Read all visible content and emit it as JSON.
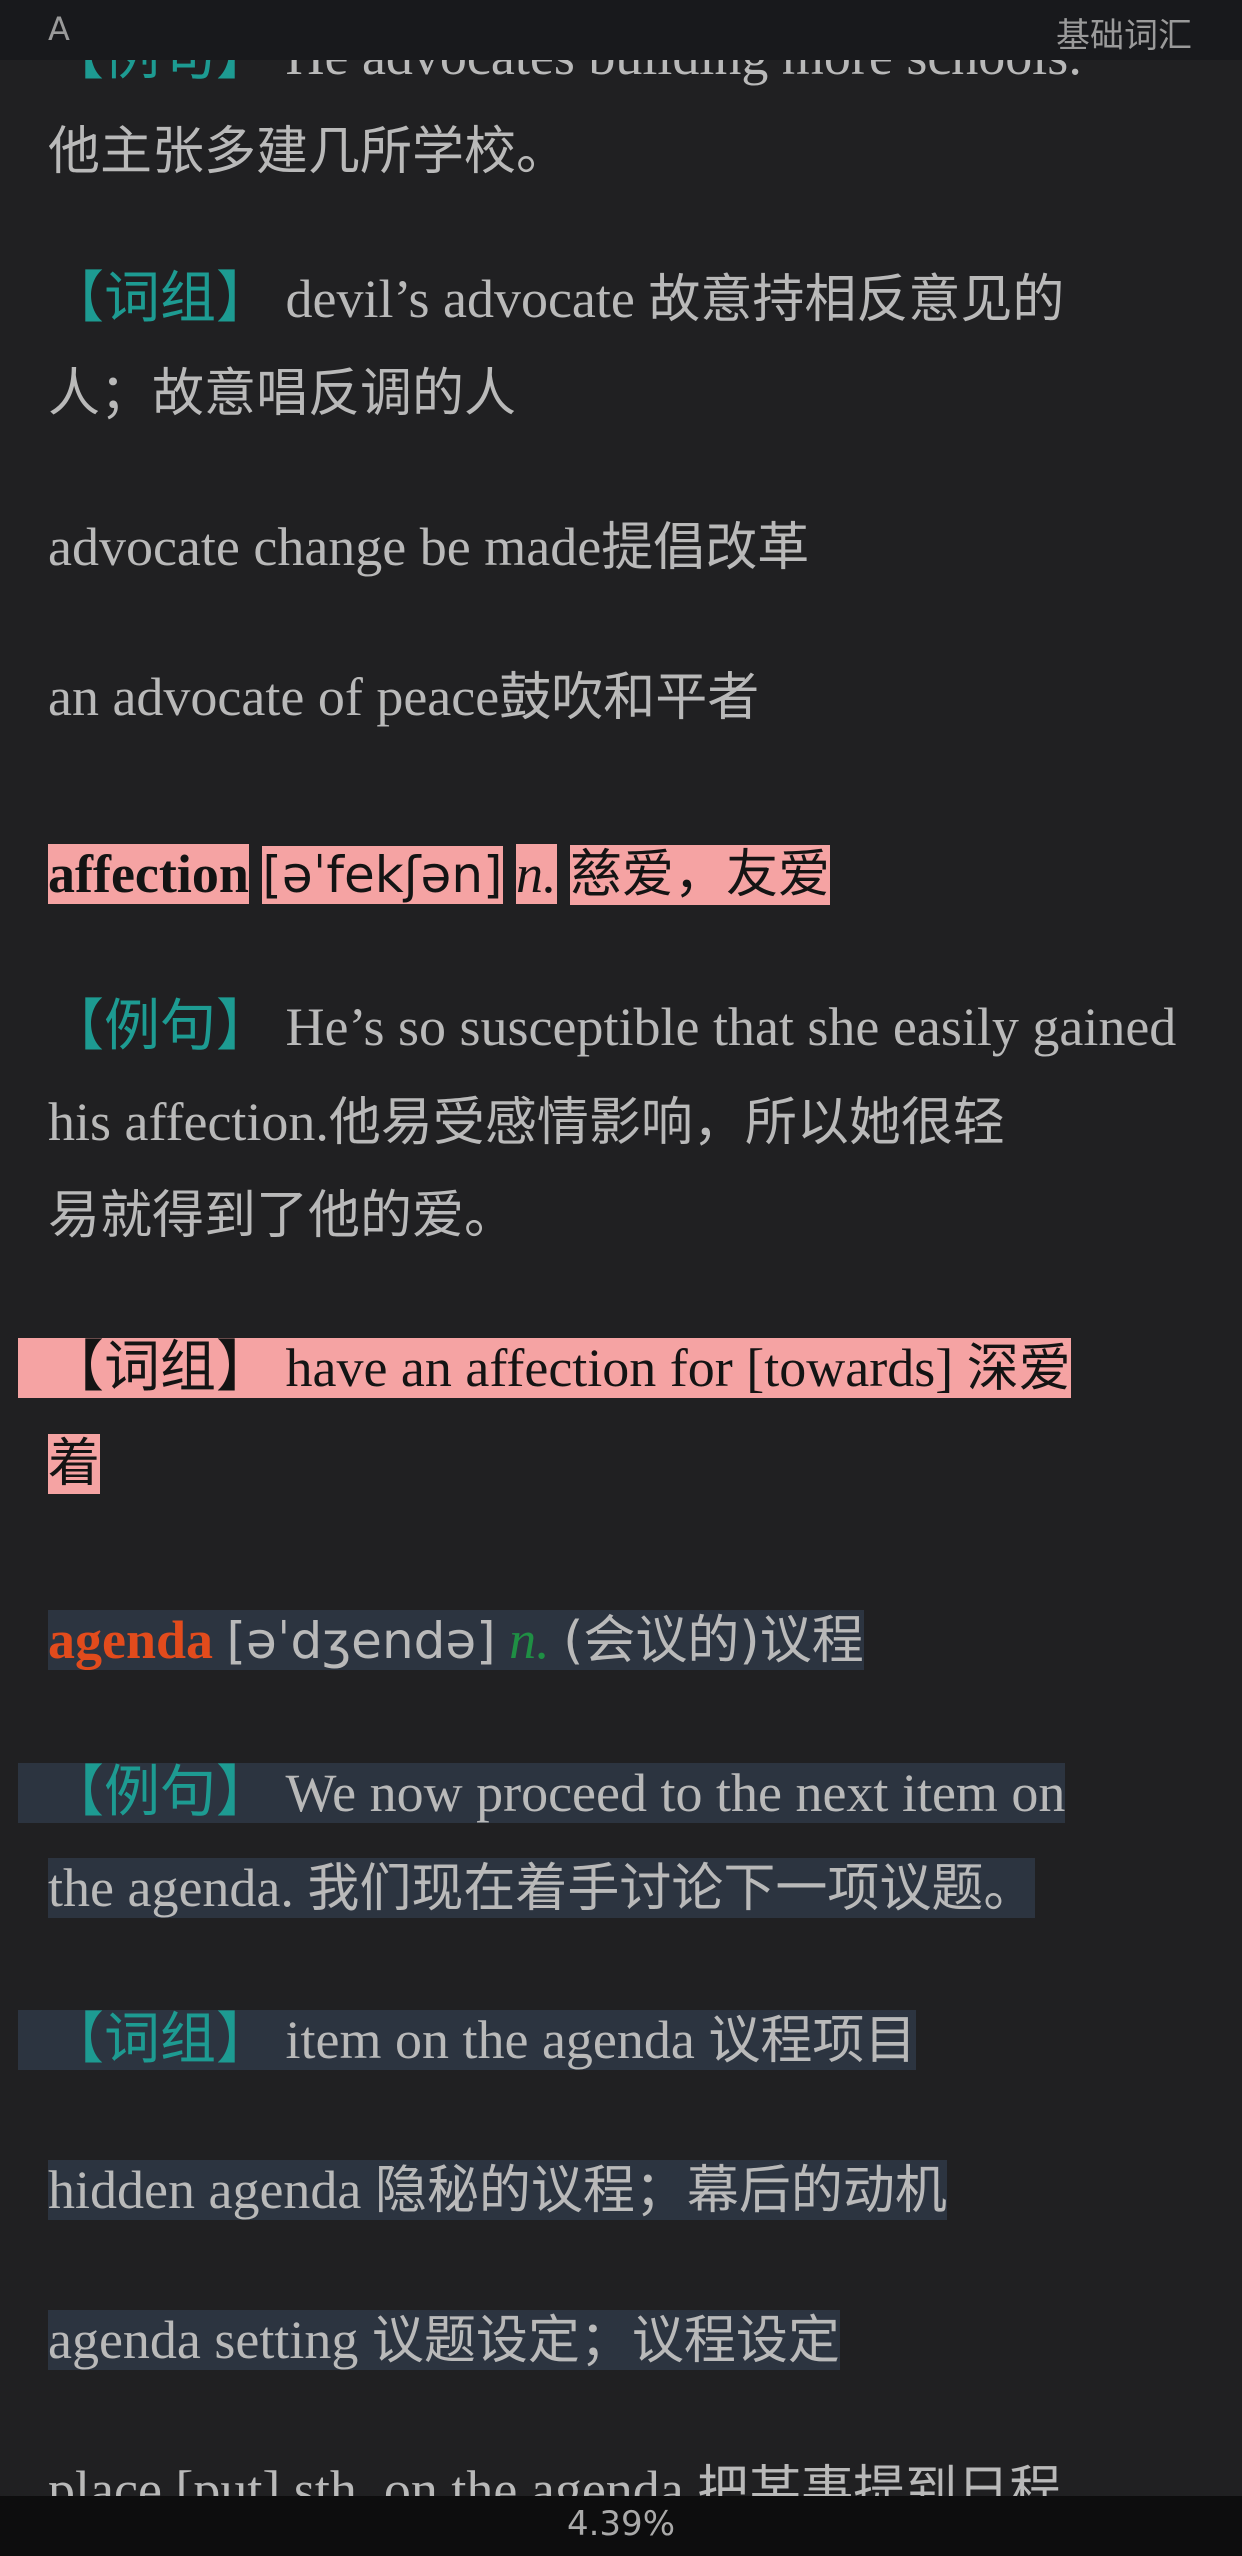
{
  "header": {
    "left_label": "A",
    "right_label": "基础词汇"
  },
  "footer": {
    "progress": "4.39%"
  },
  "advocate": {
    "example_label": "【例句】",
    "example_en_partial": "He advocates building more schools.",
    "example_zh": "他主张多建几所学校。",
    "phrase_label": "【词组】",
    "phrase1_en": "devil’s advocate",
    "phrase1_zh_a": "故意持相反意见的",
    "phrase1_zh_b": "人；故意唱反调的人",
    "phrase2": "advocate change be made",
    "phrase2_zh": "提倡改革",
    "phrase3": "an advocate of peace",
    "phrase3_zh": "鼓吹和平者"
  },
  "affection": {
    "word": "affection",
    "ipa": "[əˈfekʃən]",
    "pos": "n.",
    "meaning": "慈爱，友爱",
    "example_label": "【例句】",
    "example_en_a": "He’s so susceptible that she easily gained",
    "example_en_b": "his affection.",
    "example_zh_a": "他易受感情影响，所以她很轻",
    "example_zh_b": "易就得到了他的爱。",
    "phrase_label": "【词组】",
    "phrase_en": "have an affection for [towards]",
    "phrase_zh_a": "深爱",
    "phrase_zh_b": "着"
  },
  "agenda": {
    "word": "agenda",
    "ipa": "[əˈdʒendə]",
    "pos": "n.",
    "meaning": "(会议的)议程",
    "example_label": "【例句】",
    "example_en_a": "We now proceed to the next item on",
    "example_en_b": "the agenda.",
    "example_zh": "我们现在着手讨论下一项议题。",
    "phrase_label": "【词组】",
    "phrase1_en": "item on the agenda",
    "phrase1_zh": "议程项目",
    "phrase2_en": "hidden agenda",
    "phrase2_zh": "隐秘的议程；幕后的动机",
    "phrase3_en": "agenda setting",
    "phrase3_zh": "议题设定；议程设定",
    "phrase4_en_partial": "place [put] sth. on the agenda",
    "phrase4_zh_partial": "把某事提到日程"
  }
}
